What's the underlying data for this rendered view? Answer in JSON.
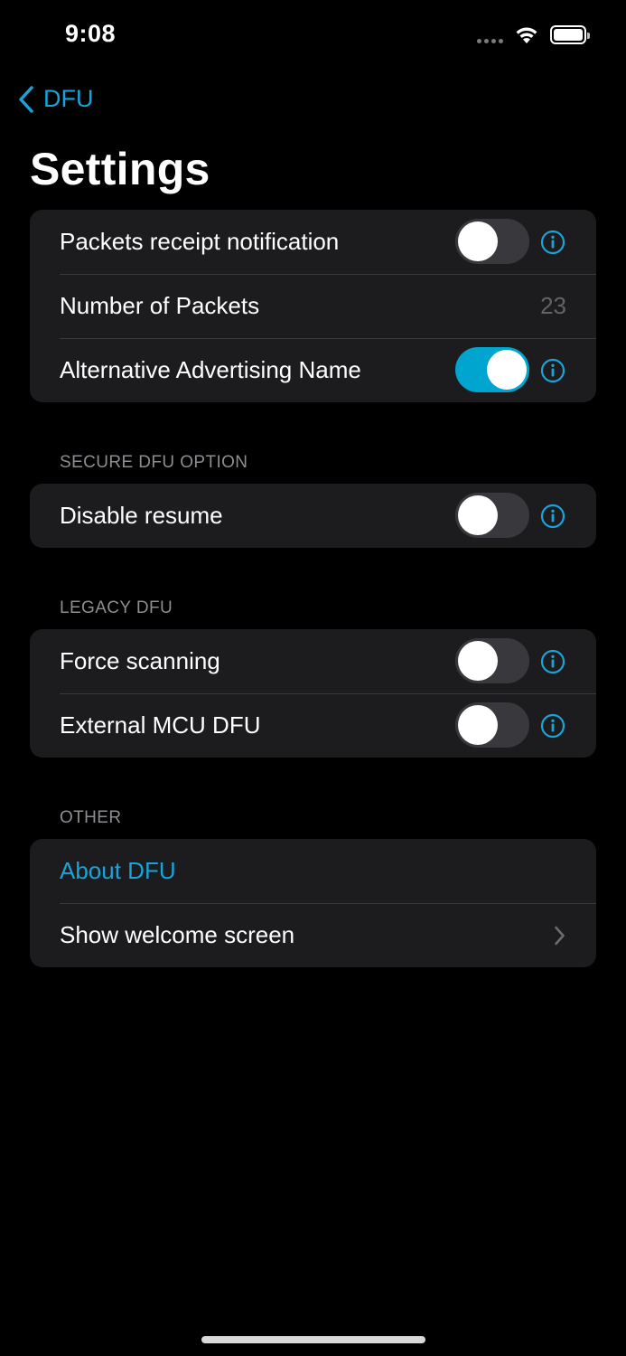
{
  "status_bar": {
    "time": "9:08",
    "icons": [
      "signal-dots-icon",
      "wifi-icon",
      "battery-icon"
    ]
  },
  "nav": {
    "back_label": "DFU",
    "back_icon": "chevron-left-icon",
    "title": "Settings"
  },
  "colors": {
    "accent": "#1aa3d8",
    "toggle_on": "#00a5cf",
    "toggle_off": "#39393d",
    "group_background": "#1c1c1e",
    "secondary_text": "#8d8d92"
  },
  "groups": [
    {
      "header": "",
      "rows": [
        {
          "label": "Packets receipt notification",
          "type": "toggle",
          "on": false,
          "info": true
        },
        {
          "label": "Number of Packets",
          "type": "value",
          "value": "23"
        },
        {
          "label": "Alternative Advertising Name",
          "type": "toggle",
          "on": true,
          "info": true
        }
      ]
    },
    {
      "header": "SECURE DFU OPTION",
      "rows": [
        {
          "label": "Disable resume",
          "type": "toggle",
          "on": false,
          "info": true
        }
      ]
    },
    {
      "header": "LEGACY DFU",
      "rows": [
        {
          "label": "Force scanning",
          "type": "toggle",
          "on": false,
          "info": true
        },
        {
          "label": "External MCU DFU",
          "type": "toggle",
          "on": false,
          "info": true
        }
      ]
    },
    {
      "header": "OTHER",
      "rows": [
        {
          "label": "About DFU",
          "type": "link"
        },
        {
          "label": "Show welcome screen",
          "type": "navigation",
          "icon": "chevron-right-icon"
        }
      ]
    }
  ]
}
